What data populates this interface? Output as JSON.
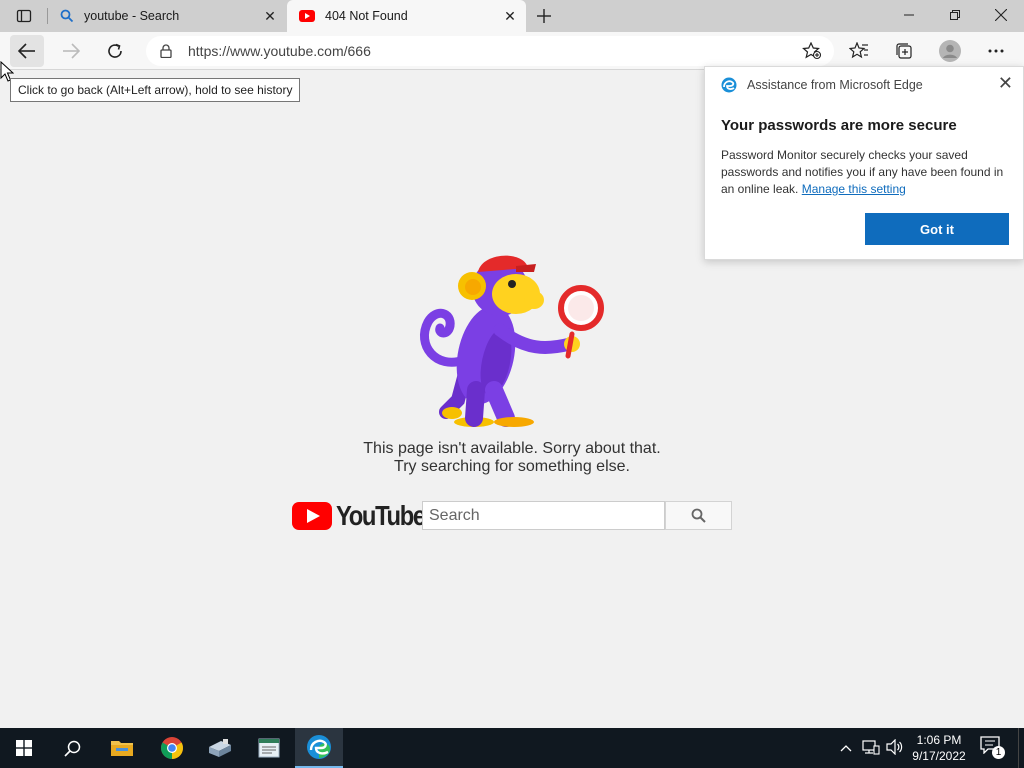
{
  "tabs": [
    {
      "title": "youtube - Search",
      "icon": "search-icon"
    },
    {
      "title": "404 Not Found",
      "icon": "youtube-favicon"
    }
  ],
  "address_bar": {
    "url": "https://www.youtube.com/666"
  },
  "tooltip": {
    "text": "Click to go back (Alt+Left arrow), hold to see history"
  },
  "popup": {
    "header": "Assistance from Microsoft Edge",
    "title": "Your passwords are more secure",
    "body": "Password Monitor securely checks your saved passwords and notifies you if any have been found in an online leak.",
    "link": "Manage this setting",
    "button": "Got it"
  },
  "page": {
    "line1": "This page isn't available. Sorry about that.",
    "line2": "Try searching for something else.",
    "logo_text": "YouTube",
    "search_placeholder": "Search"
  },
  "taskbar": {
    "time": "1:06 PM",
    "date": "9/17/2022",
    "notification_count": "1"
  },
  "colors": {
    "accent": "#0f6cbd",
    "youtube_red": "#ff0000",
    "taskbar": "#101820"
  }
}
